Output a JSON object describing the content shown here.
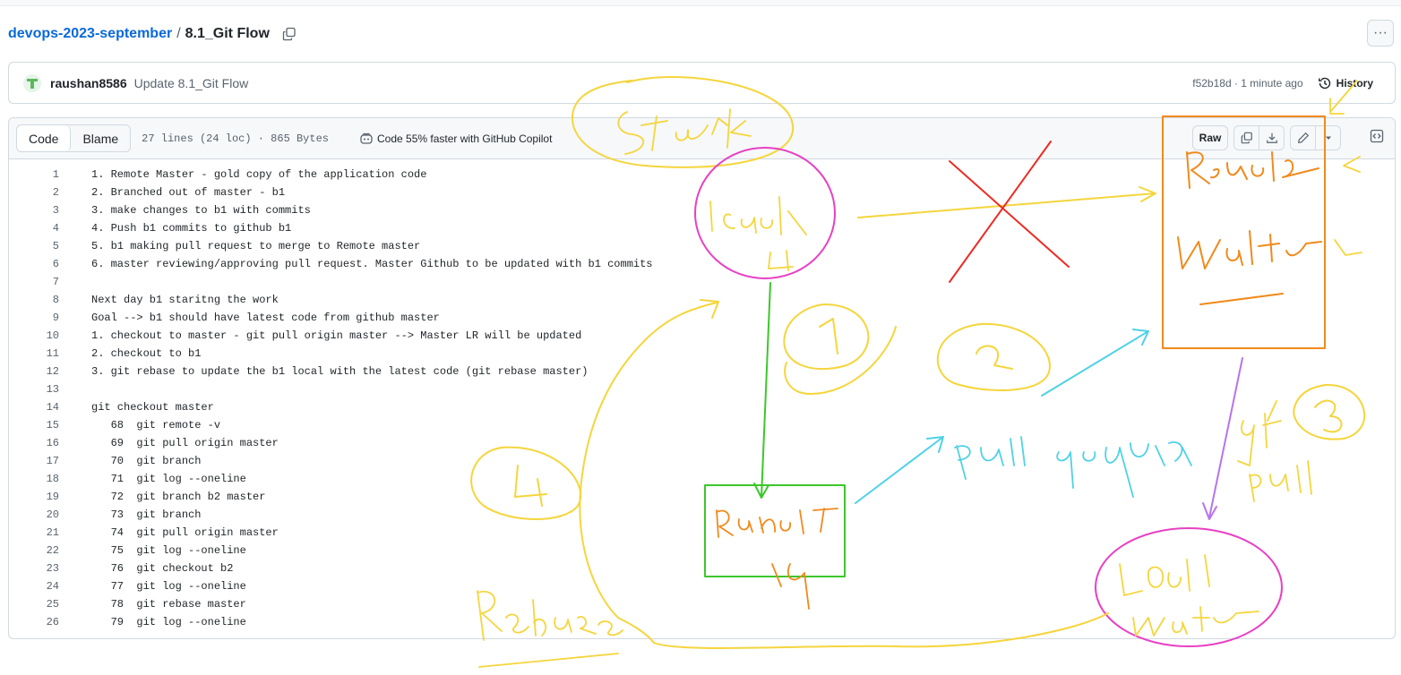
{
  "breadcrumb": {
    "repo": "devops-2023-september",
    "separator": "/",
    "file": "8.1_Git Flow"
  },
  "commit": {
    "author": "raushan8586",
    "message": "Update 8.1_Git Flow",
    "meta": "f52b18d · 1 minute ago",
    "history_label": "History"
  },
  "toolbar": {
    "code_tab": "Code",
    "blame_tab": "Blame",
    "stats": "27 lines (24 loc) · 865 Bytes",
    "copilot": "Code 55% faster with GitHub Copilot",
    "raw": "Raw"
  },
  "lines": [
    {
      "n": "1",
      "t": "1. Remote Master - gold copy of the application code"
    },
    {
      "n": "2",
      "t": "2. Branched out of master - b1"
    },
    {
      "n": "3",
      "t": "3. make changes to b1 with commits"
    },
    {
      "n": "4",
      "t": "4. Push b1 commits to github b1"
    },
    {
      "n": "5",
      "t": "5. b1 making pull request to merge to Remote master"
    },
    {
      "n": "6",
      "t": "6. master reviewing/approving pull request. Master Github to be updated with b1 commits"
    },
    {
      "n": "7",
      "t": ""
    },
    {
      "n": "8",
      "t": "Next day b1 staritng the work"
    },
    {
      "n": "9",
      "t": "Goal --> b1 should have latest code from github master"
    },
    {
      "n": "10",
      "t": "1. checkout to master - git pull origin master --> Master LR will be updated"
    },
    {
      "n": "11",
      "t": "2. checkout to b1"
    },
    {
      "n": "12",
      "t": "3. git rebase to update the b1 local with the latest code (git rebase master)"
    },
    {
      "n": "13",
      "t": ""
    },
    {
      "n": "14",
      "t": "git checkout master"
    },
    {
      "n": "15",
      "t": "   68  git remote -v"
    },
    {
      "n": "16",
      "t": "   69  git pull origin master"
    },
    {
      "n": "17",
      "t": "   70  git branch"
    },
    {
      "n": "18",
      "t": "   71  git log --oneline"
    },
    {
      "n": "19",
      "t": "   72  git branch b2 master"
    },
    {
      "n": "20",
      "t": "   73  git branch"
    },
    {
      "n": "21",
      "t": "   74  git pull origin master"
    },
    {
      "n": "22",
      "t": "   75  git log --oneline"
    },
    {
      "n": "23",
      "t": "   76  git checkout b2"
    },
    {
      "n": "24",
      "t": "   77  git log --oneline"
    },
    {
      "n": "25",
      "t": "   78  git rebase master"
    },
    {
      "n": "26",
      "t": "   79  git log --oneline"
    }
  ],
  "colors": {
    "link": "#0969da",
    "ink_yellow": "#f5d53c",
    "ink_orange": "#f08a1c",
    "ink_magenta": "#e840c4",
    "ink_green": "#3cc72b",
    "ink_cyan": "#4fd1e6",
    "ink_red": "#ee2a23",
    "ink_purple": "#b774ec"
  }
}
